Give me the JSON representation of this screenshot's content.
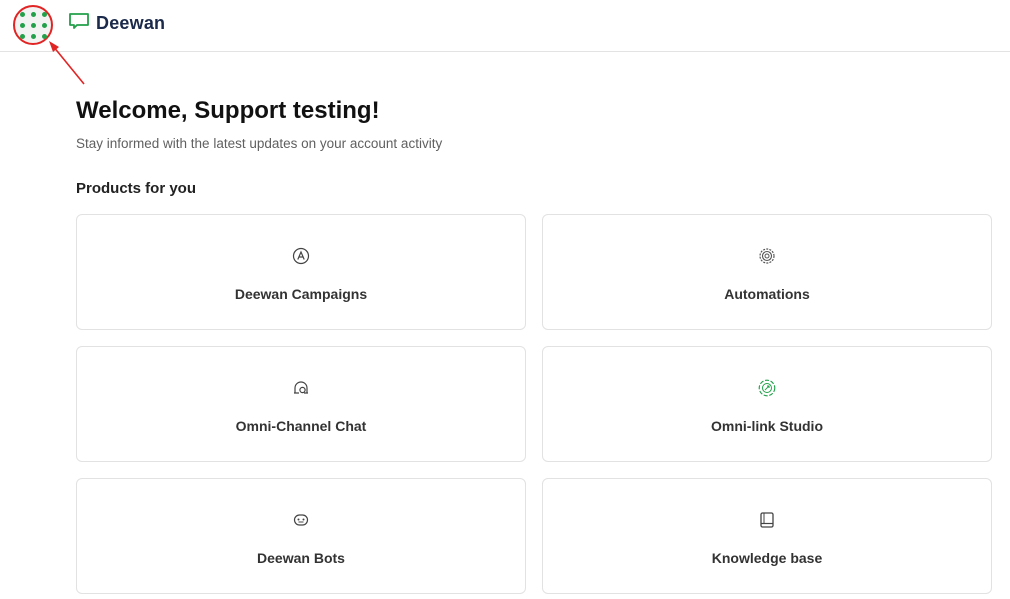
{
  "header": {
    "brand": "Deewan",
    "apps_icon": "grid-dots-icon",
    "logo_icon": "chat-bubble-icon"
  },
  "main": {
    "welcome": "Welcome, Support testing!",
    "subtitle": "Stay informed with the latest updates on your account activity",
    "products_title": "Products for you",
    "products": [
      {
        "label": "Deewan Campaigns",
        "icon": "campaign-a-icon"
      },
      {
        "label": "Automations",
        "icon": "target-icon"
      },
      {
        "label": "Omni-Channel Chat",
        "icon": "chat-icon"
      },
      {
        "label": "Omni-link Studio",
        "icon": "link-studio-icon"
      },
      {
        "label": "Deewan Bots",
        "icon": "bot-icon"
      },
      {
        "label": "Knowledge base",
        "icon": "book-icon"
      }
    ]
  },
  "colors": {
    "accent_green": "#23a04a",
    "annotation_red": "#e12424",
    "brand_navy": "#1b2a4a"
  }
}
